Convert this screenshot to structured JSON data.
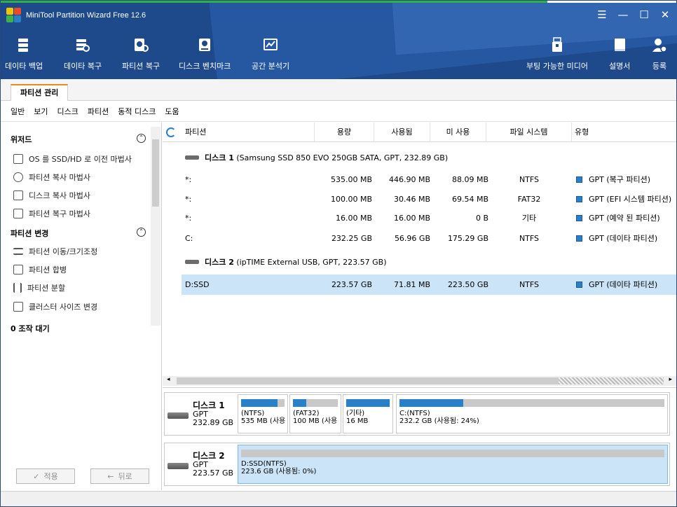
{
  "app": {
    "title": "MiniTool Partition Wizard Free 12.6"
  },
  "window_controls": {
    "menu": "☰",
    "minimize": "—",
    "maximize": "☐",
    "close": "✕"
  },
  "toolbar": {
    "data_backup": "데이타 백업",
    "data_recovery": "데이타 복구",
    "partition_recovery": "파티션 복구",
    "disk_benchmark": "디스크 벤치마크",
    "space_analyzer": "공간 분석기",
    "bootable_media": "부팅 가능한 미디어",
    "manual": "설명서",
    "register": "등록"
  },
  "tab": {
    "label": "파티션 관리"
  },
  "menu": [
    "일반",
    "보기",
    "디스크",
    "파티션",
    "동적 디스크",
    "도움"
  ],
  "sidebar": {
    "wizard_title": "위저드",
    "wizard_items": [
      "OS 를 SSD/HD 로 이전 마법사",
      "파티션 복사 마법사",
      "디스크 복사 마법사",
      "파티션 복구 마법사"
    ],
    "change_title": "파티션 변경",
    "change_items": [
      "파티션 이동/크기조정",
      "파티션 합병",
      "파티션 분할",
      "클러스터 사이즈 변경"
    ],
    "pending": "0 조작 대기",
    "apply": "적용",
    "undo": "뒤로",
    "apply_icon": "✓",
    "undo_icon": "←"
  },
  "table": {
    "headers": [
      "파티션",
      "용량",
      "사용됨",
      "미 사용",
      "파일 시스템",
      "유형"
    ],
    "disk1": {
      "name": "디스크 1",
      "desc": "(Samsung SSD 850 EVO 250GB SATA, GPT, 232.89 GB)"
    },
    "disk2": {
      "name": "디스크 2",
      "desc": "(ipTIME External USB, GPT, 223.57 GB)"
    },
    "rows": [
      {
        "partition": "*:",
        "capacity": "535.00 MB",
        "used": "446.90 MB",
        "unused": "88.09 MB",
        "fs": "NTFS",
        "type": "GPT (복구 파티션)"
      },
      {
        "partition": "*:",
        "capacity": "100.00 MB",
        "used": "30.46 MB",
        "unused": "69.54 MB",
        "fs": "FAT32",
        "type": "GPT (EFI 시스템 파티션)"
      },
      {
        "partition": "*:",
        "capacity": "16.00 MB",
        "used": "16.00 MB",
        "unused": "0 B",
        "fs": "기타",
        "type": "GPT (예약 된 파티션)"
      },
      {
        "partition": "C:",
        "capacity": "232.25 GB",
        "used": "56.96 GB",
        "unused": "175.29 GB",
        "fs": "NTFS",
        "type": "GPT (데이타 파티션)"
      },
      {
        "partition": "D:SSD",
        "capacity": "223.57 GB",
        "used": "71.81 MB",
        "unused": "223.50 GB",
        "fs": "NTFS",
        "type": "GPT (데이타 파티션)"
      }
    ]
  },
  "diskmap": {
    "disk1": {
      "name": "디스크 1",
      "scheme": "GPT",
      "size": "232.89 GB",
      "parts": [
        {
          "line1": "(NTFS)",
          "line2": "535 MB (사용",
          "used_pct": 84
        },
        {
          "line1": "(FAT32)",
          "line2": "100 MB (사용",
          "used_pct": 30
        },
        {
          "line1": "(기타)",
          "line2": "16 MB",
          "used_pct": 100
        },
        {
          "line1": "C:(NTFS)",
          "line2": "232.2 GB (사용됨: 24%)",
          "used_pct": 24
        }
      ]
    },
    "disk2": {
      "name": "디스크 2",
      "scheme": "GPT",
      "size": "223.57 GB",
      "parts": [
        {
          "line1": "D:SSD(NTFS)",
          "line2": "223.6 GB (사용됨: 0%)",
          "used_pct": 0
        }
      ]
    }
  },
  "colors": {
    "header_bg": "#1e4a8c",
    "accent": "#2a7fc9",
    "selected": "#cce4f7",
    "tab_accent": "#e98a1b"
  }
}
